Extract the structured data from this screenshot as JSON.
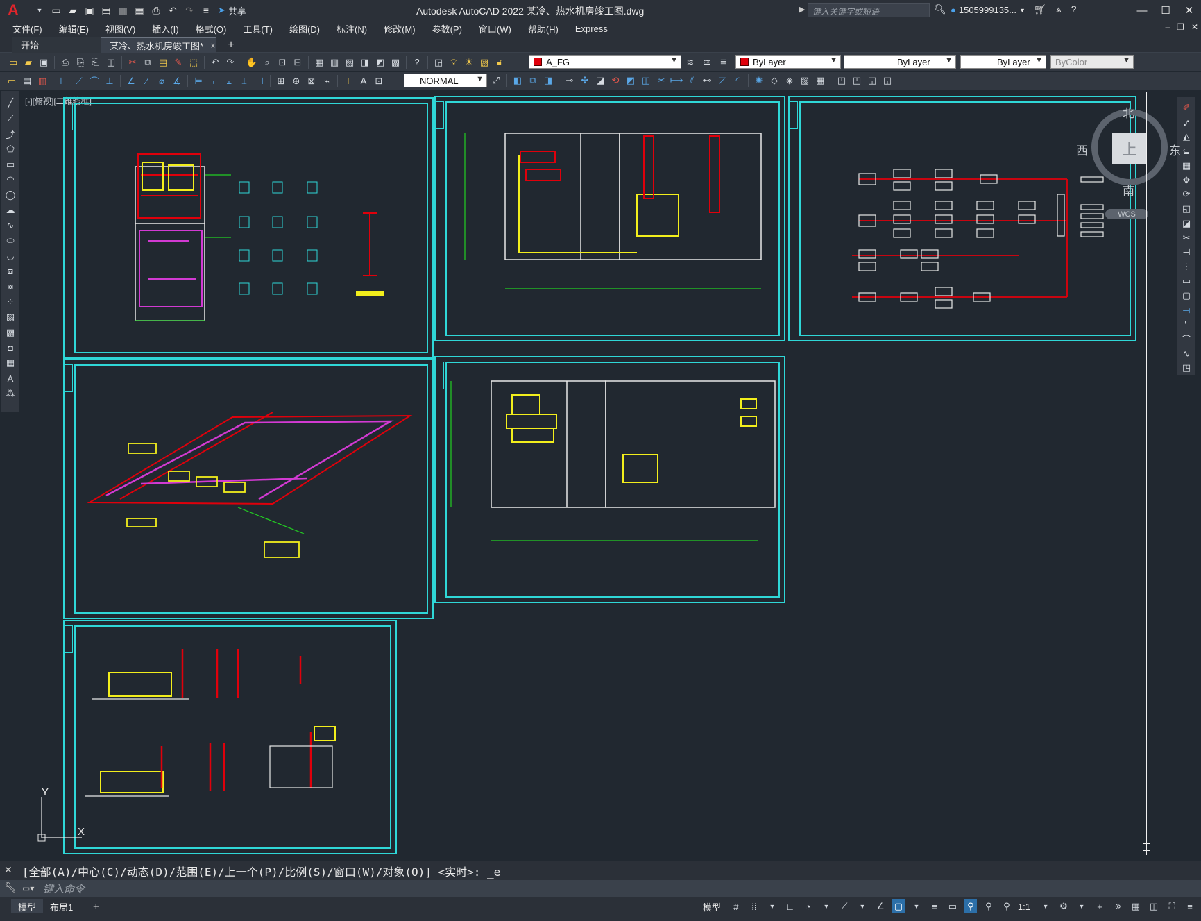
{
  "app": {
    "window_title": "Autodesk AutoCAD 2022    某冷、热水机房竣工图.dwg",
    "share_label": "共享",
    "search_placeholder": "键入关键字或短语",
    "user_name": "1505999135...",
    "logo_letter": "A"
  },
  "menu": {
    "items": [
      "文件(F)",
      "编辑(E)",
      "视图(V)",
      "插入(I)",
      "格式(O)",
      "工具(T)",
      "绘图(D)",
      "标注(N)",
      "修改(M)",
      "参数(P)",
      "窗口(W)",
      "帮助(H)",
      "Express"
    ]
  },
  "tabs": {
    "start": "开始",
    "document": "某冷、热水机房竣工图*",
    "close_glyph": "×",
    "add_glyph": "+"
  },
  "properties": {
    "layer": "A_FG",
    "color": "ByLayer",
    "linetype": "ByLayer",
    "lineweight": "ByLayer",
    "plotstyle": "ByColor",
    "text_style": "NORMAL",
    "layer_color": "#e0000b"
  },
  "viewport": {
    "label": "[-][俯视][二维线框]"
  },
  "navcube": {
    "north": "北",
    "south": "南",
    "west": "西",
    "east": "东",
    "top": "上",
    "wcs": "WCS"
  },
  "ucs": {
    "x_label": "X",
    "y_label": "Y"
  },
  "command": {
    "history": "[全部(A)/中心(C)/动态(D)/范围(E)/上一个(P)/比例(S)/窗口(W)/对象(O)] <实时>: _e",
    "placeholder": "键入命令"
  },
  "status": {
    "model_tab": "模型",
    "layout_tab": "布局1",
    "add_glyph": "+",
    "model_label": "模型",
    "scale": "1:1"
  },
  "colors": {
    "sheet_border": "#2fd7d7",
    "background": "#212830",
    "pipe_red": "#e0000b",
    "pipe_magenta": "#d23ad2",
    "pipe_yellow": "#f2ee1c",
    "green": "#22d022"
  }
}
